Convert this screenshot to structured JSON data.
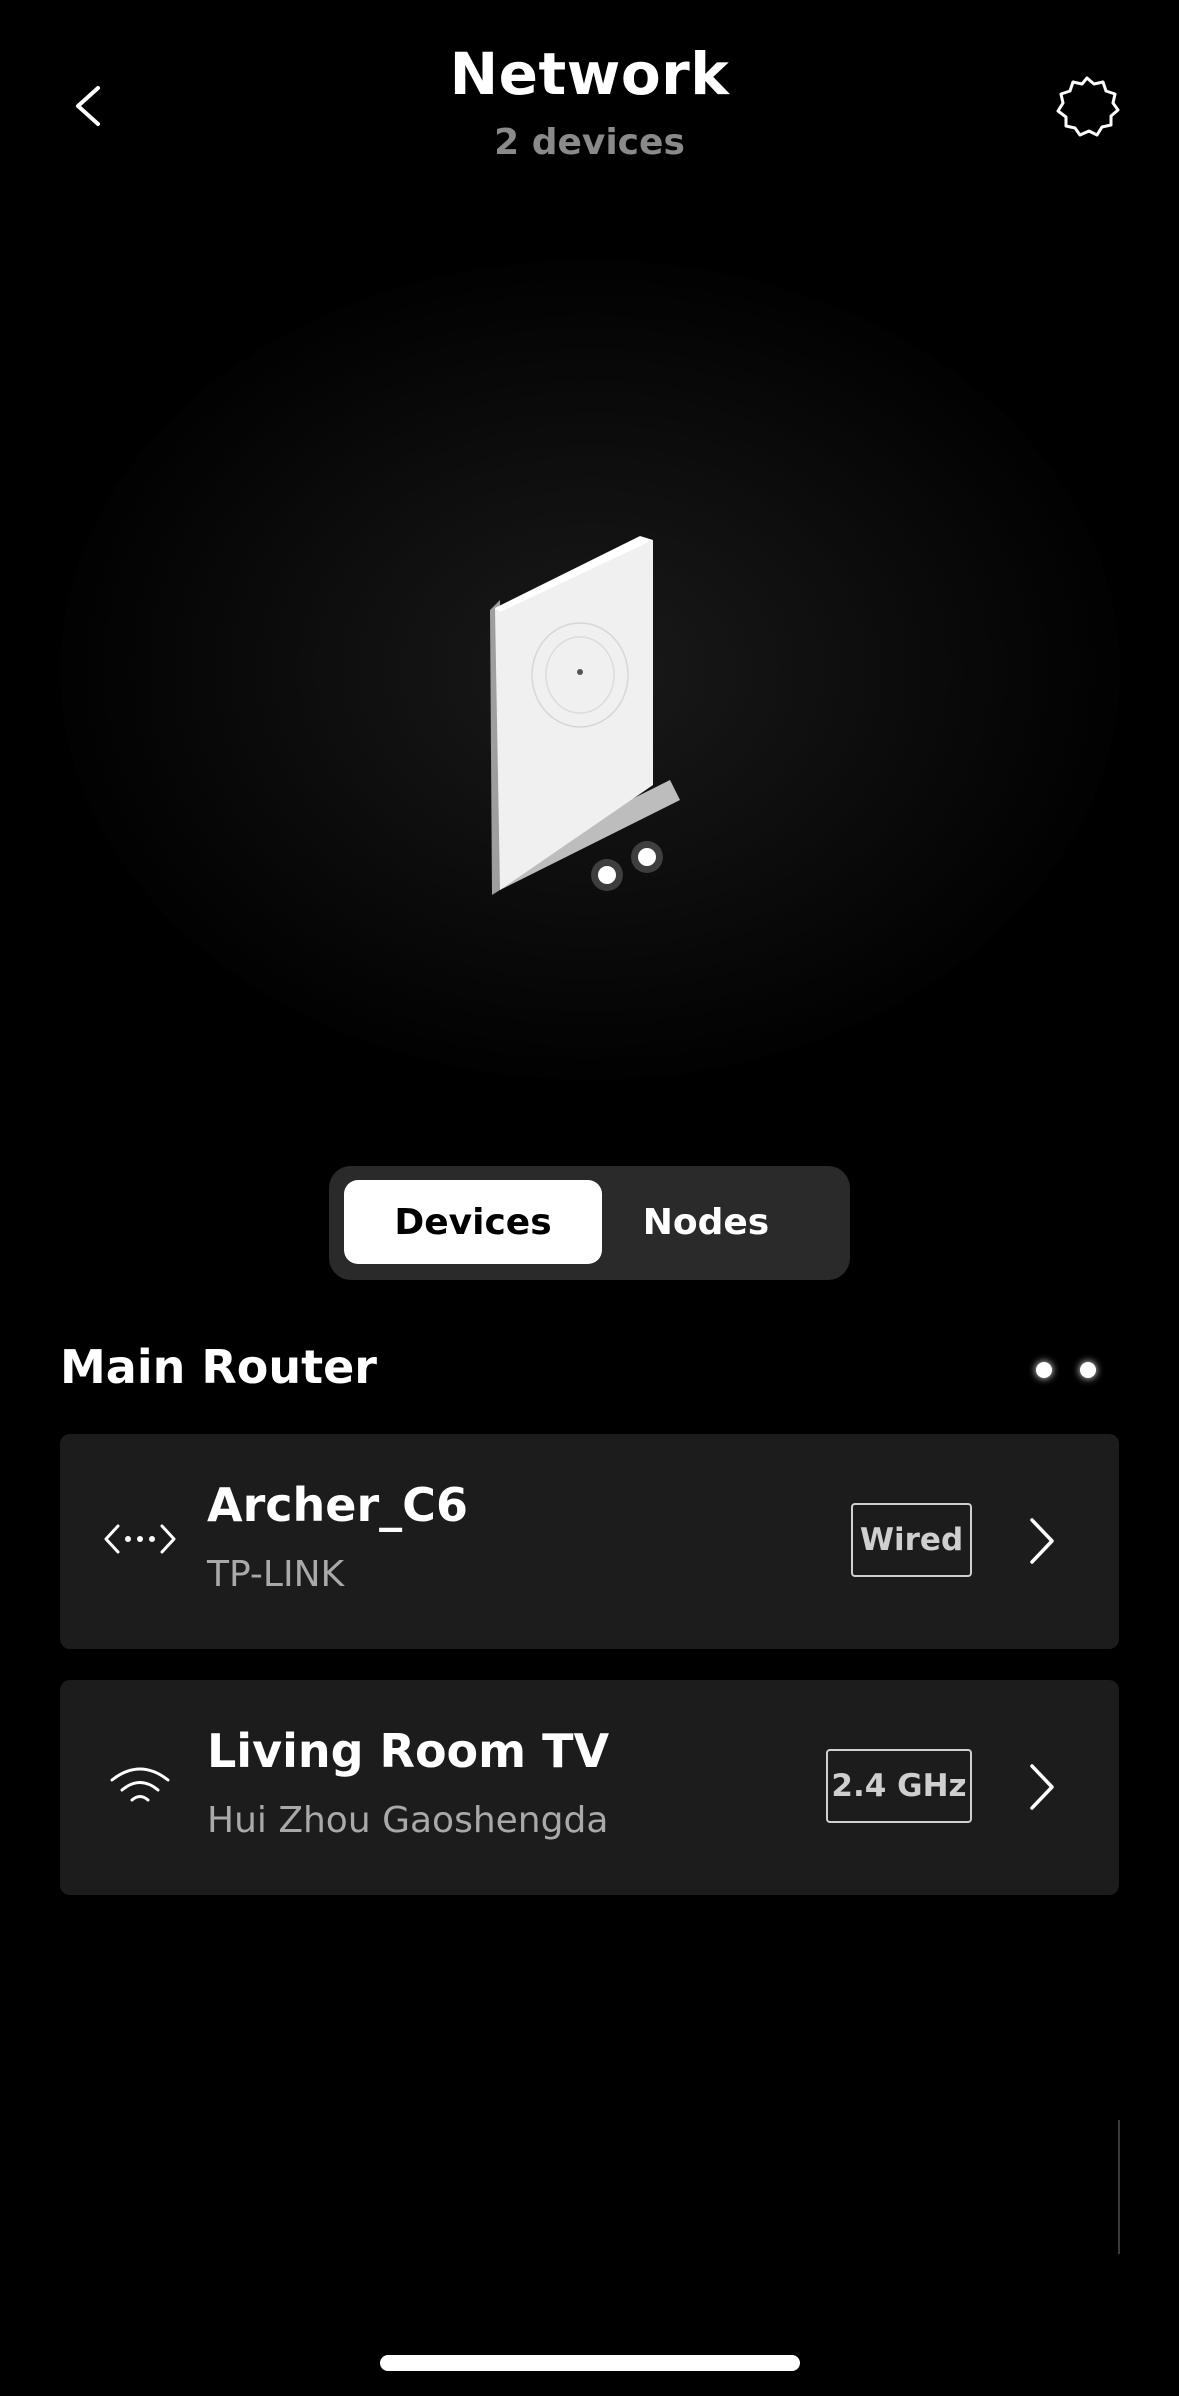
{
  "header": {
    "title": "Network",
    "subtitle": "2 devices",
    "back_icon": "chevron-left-icon",
    "settings_icon": "gear-icon"
  },
  "tabs": {
    "items": [
      {
        "label": "Devices",
        "selected": true
      },
      {
        "label": "Nodes",
        "selected": false
      }
    ]
  },
  "section": {
    "title": "Main Router"
  },
  "devices": [
    {
      "name": "Archer_C6",
      "vendor": "TP-LINK",
      "connection": "Wired",
      "icon": "ethernet-icon"
    },
    {
      "name": "Living Room TV",
      "vendor": "Hui Zhou Gaoshengda",
      "connection": "2.4 GHz",
      "icon": "wifi-icon"
    }
  ],
  "colors": {
    "background": "#000000",
    "card": "#1c1c1c",
    "segment_bg": "#2a2a2a",
    "muted_text": "#8a8a8a"
  }
}
